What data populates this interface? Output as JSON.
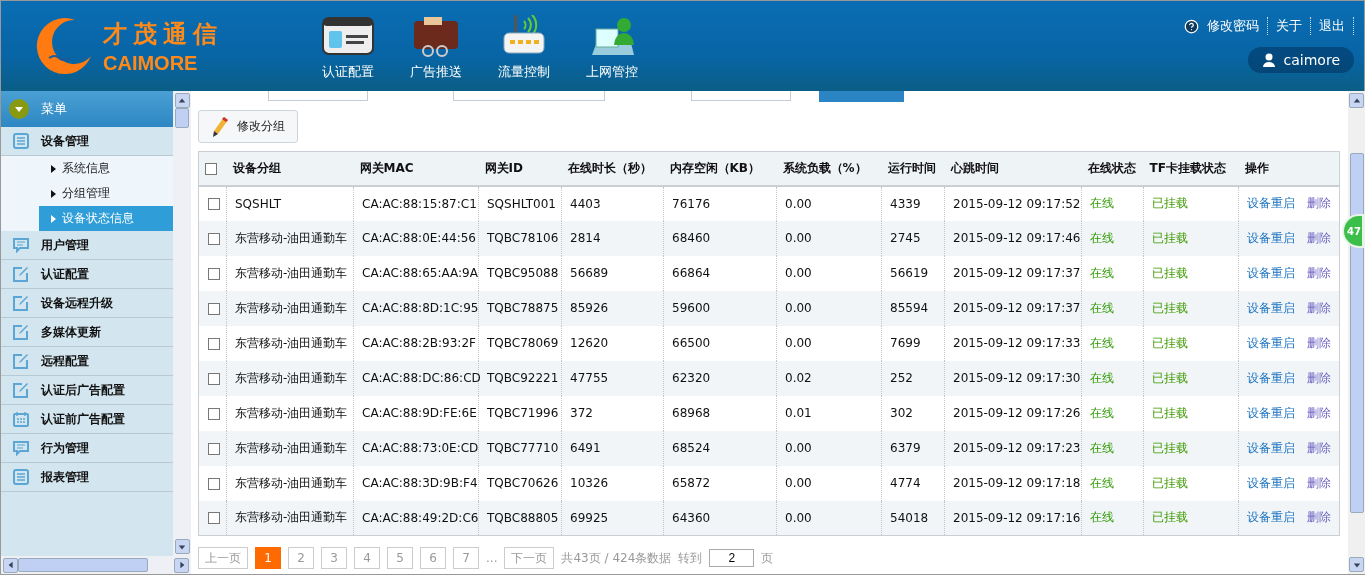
{
  "header": {
    "logo": {
      "cn": "才茂通信",
      "en": "CAIMORE"
    },
    "nav": [
      {
        "label": "认证配置",
        "kind": "card"
      },
      {
        "label": "广告推送",
        "kind": "wallet"
      },
      {
        "label": "流量控制",
        "kind": "router"
      },
      {
        "label": "上网管控",
        "kind": "user"
      }
    ],
    "links": [
      "修改密码",
      "关于",
      "退出"
    ],
    "user": "caimore"
  },
  "sidebar": {
    "title": "菜单",
    "items": [
      {
        "label": "设备管理",
        "kind": "list",
        "children": [
          {
            "label": "系统信息",
            "selected": false
          },
          {
            "label": "分组管理",
            "selected": false
          },
          {
            "label": "设备状态信息",
            "selected": true
          }
        ]
      },
      {
        "label": "用户管理",
        "kind": "chat"
      },
      {
        "label": "认证配置",
        "kind": "edit"
      },
      {
        "label": "设备远程升级",
        "kind": "edit"
      },
      {
        "label": "多媒体更新",
        "kind": "edit"
      },
      {
        "label": "远程配置",
        "kind": "edit"
      },
      {
        "label": "认证后广告配置",
        "kind": "edit"
      },
      {
        "label": "认证前广告配置",
        "kind": "calendar"
      },
      {
        "label": "行为管理",
        "kind": "chat"
      },
      {
        "label": "报表管理",
        "kind": "list"
      }
    ]
  },
  "toolbar": {
    "button": "修改分组"
  },
  "table": {
    "select_all": false,
    "columns": [
      "设备分组",
      "网关MAC",
      "网关ID",
      "在线时长（秒）",
      "内存空闲（KB）",
      "系统负载（%）",
      "运行时间",
      "心跳时间",
      "在线状态",
      "TF卡挂载状态",
      "操作"
    ],
    "rows": [
      {
        "checked": false,
        "cells": [
          "SQSHLT",
          "CA:AC:88:15:87:C1",
          "SQSHLT001",
          "4403",
          "76176",
          "0.00",
          "4339",
          "2015-09-12 09:17:52",
          "在线",
          "已挂载"
        ],
        "actions": [
          "设备重启",
          "删除"
        ]
      },
      {
        "checked": false,
        "cells": [
          "东营移动-油田通勤车",
          "CA:AC:88:0E:44:56",
          "TQBC78106",
          "2814",
          "68460",
          "0.00",
          "2745",
          "2015-09-12 09:17:46",
          "在线",
          "已挂载"
        ],
        "actions": [
          "设备重启",
          "删除"
        ]
      },
      {
        "checked": false,
        "cells": [
          "东营移动-油田通勤车",
          "CA:AC:88:65:AA:9A",
          "TQBC95088",
          "56689",
          "66864",
          "0.00",
          "56619",
          "2015-09-12 09:17:37",
          "在线",
          "已挂载"
        ],
        "actions": [
          "设备重启",
          "删除"
        ]
      },
      {
        "checked": false,
        "cells": [
          "东营移动-油田通勤车",
          "CA:AC:88:8D:1C:95",
          "TQBC78875",
          "85926",
          "59600",
          "0.00",
          "85594",
          "2015-09-12 09:17:37",
          "在线",
          "已挂载"
        ],
        "actions": [
          "设备重启",
          "删除"
        ]
      },
      {
        "checked": false,
        "cells": [
          "东营移动-油田通勤车",
          "CA:AC:88:2B:93:2F",
          "TQBC78069",
          "12620",
          "66500",
          "0.00",
          "7699",
          "2015-09-12 09:17:33",
          "在线",
          "已挂载"
        ],
        "actions": [
          "设备重启",
          "删除"
        ]
      },
      {
        "checked": false,
        "cells": [
          "东营移动-油田通勤车",
          "CA:AC:88:DC:86:CD",
          "TQBC92221",
          "47755",
          "62320",
          "0.02",
          "252",
          "2015-09-12 09:17:30",
          "在线",
          "已挂载"
        ],
        "actions": [
          "设备重启",
          "删除"
        ]
      },
      {
        "checked": false,
        "cells": [
          "东营移动-油田通勤车",
          "CA:AC:88:9D:FE:6E",
          "TQBC71996",
          "372",
          "68968",
          "0.01",
          "302",
          "2015-09-12 09:17:26",
          "在线",
          "已挂载"
        ],
        "actions": [
          "设备重启",
          "删除"
        ]
      },
      {
        "checked": false,
        "cells": [
          "东营移动-油田通勤车",
          "CA:AC:88:73:0E:CD",
          "TQBC77710",
          "6491",
          "68524",
          "0.00",
          "6379",
          "2015-09-12 09:17:23",
          "在线",
          "已挂载"
        ],
        "actions": [
          "设备重启",
          "删除"
        ]
      },
      {
        "checked": false,
        "cells": [
          "东营移动-油田通勤车",
          "CA:AC:88:3D:9B:F4",
          "TQBC70626",
          "10326",
          "65872",
          "0.00",
          "4774",
          "2015-09-12 09:17:18",
          "在线",
          "已挂载"
        ],
        "actions": [
          "设备重启",
          "删除"
        ]
      },
      {
        "checked": false,
        "cells": [
          "东营移动-油田通勤车",
          "CA:AC:88:49:2D:C6",
          "TQBC88805",
          "69925",
          "64360",
          "0.00",
          "54018",
          "2015-09-12 09:17:16",
          "在线",
          "已挂载"
        ],
        "actions": [
          "设备重启",
          "删除"
        ]
      }
    ]
  },
  "pagination": {
    "prev": "上一页",
    "pages": [
      {
        "label": "1",
        "selected": true
      },
      {
        "label": "2",
        "selected": false
      },
      {
        "label": "3",
        "selected": false
      },
      {
        "label": "4",
        "selected": false
      },
      {
        "label": "5",
        "selected": false
      },
      {
        "label": "6",
        "selected": false
      },
      {
        "label": "7",
        "selected": false
      }
    ],
    "ellipsis": "...",
    "next": "下一页",
    "summary": "共43页 / 424条数据",
    "goto_label": "转到",
    "goto_value": "2",
    "goto_unit": "页"
  },
  "float_badge": "47"
}
